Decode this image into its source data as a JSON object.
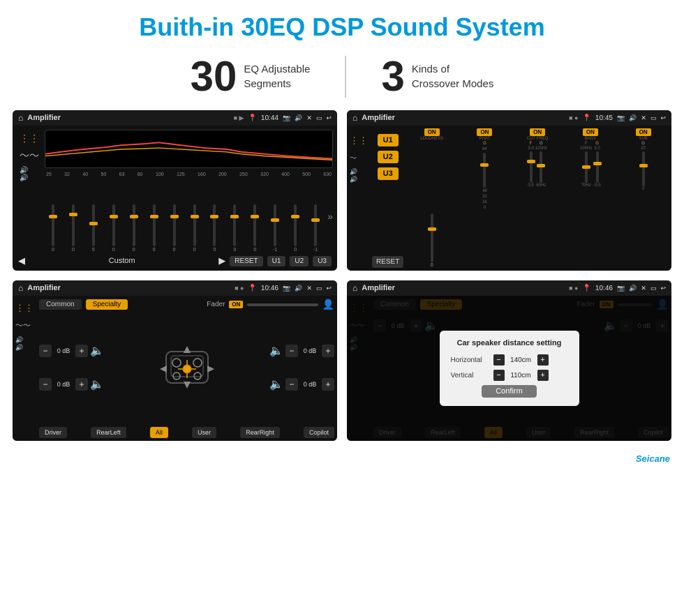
{
  "header": {
    "title": "Buith-in 30EQ DSP Sound System"
  },
  "stats": [
    {
      "number": "30",
      "text_line1": "EQ Adjustable",
      "text_line2": "Segments"
    },
    {
      "number": "3",
      "text_line1": "Kinds of",
      "text_line2": "Crossover Modes"
    }
  ],
  "screens": {
    "screen1": {
      "title": "Amplifier",
      "time": "10:44",
      "freq_labels": [
        "25",
        "32",
        "40",
        "50",
        "63",
        "80",
        "100",
        "125",
        "160",
        "200",
        "250",
        "320",
        "400",
        "500",
        "630"
      ],
      "mode_label": "Custom",
      "buttons": [
        "RESET",
        "U1",
        "U2",
        "U3"
      ]
    },
    "screen2": {
      "title": "Amplifier",
      "time": "10:45",
      "channels": [
        "LOUDNESS",
        "PHAT",
        "CUT FREQ",
        "BASS",
        "SUB"
      ],
      "u_buttons": [
        "U1",
        "U2",
        "U3"
      ],
      "reset_label": "RESET"
    },
    "screen3": {
      "title": "Amplifier",
      "time": "10:46",
      "tabs": [
        "Common",
        "Specialty"
      ],
      "fader_label": "Fader",
      "on_label": "ON",
      "speaker_labels": [
        "Driver",
        "RearLeft",
        "All",
        "User",
        "RearRight",
        "Copilot"
      ],
      "db_values": [
        "0 dB",
        "0 dB",
        "0 dB",
        "0 dB"
      ]
    },
    "screen4": {
      "title": "Amplifier",
      "time": "10:46",
      "tabs": [
        "Common",
        "Specialty"
      ],
      "dialog": {
        "title": "Car speaker distance setting",
        "horizontal_label": "Horizontal",
        "horizontal_value": "140cm",
        "vertical_label": "Vertical",
        "vertical_value": "110cm",
        "confirm_label": "Confirm"
      },
      "speaker_labels": [
        "Driver",
        "RearLeft",
        "All",
        "User",
        "RearRight",
        "Copilot"
      ],
      "db_values": [
        "0 dB",
        "0 dB"
      ]
    }
  },
  "watermark": "Seicane"
}
